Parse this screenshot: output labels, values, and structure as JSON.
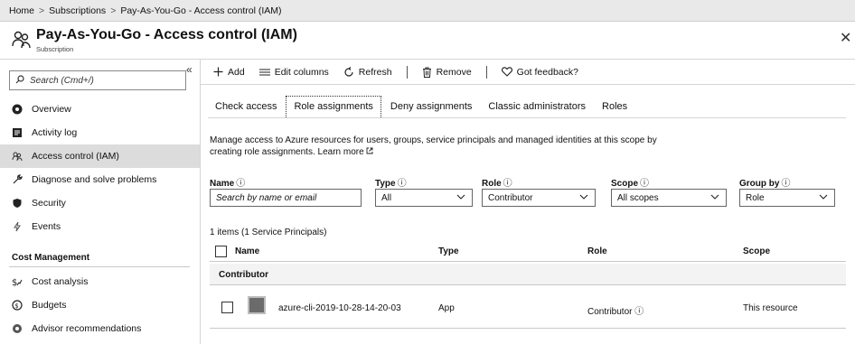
{
  "breadcrumb": {
    "items": [
      "Home",
      "Subscriptions",
      "Pay-As-You-Go - Access control (IAM)"
    ],
    "separator": ">"
  },
  "header": {
    "title": "Pay-As-You-Go - Access control (IAM)",
    "subtitle": "Subscription",
    "close_label": "✕",
    "icon": "people-icon"
  },
  "sidebar": {
    "search_placeholder": "Search (Cmd+/)",
    "collapse_label": "«",
    "items": [
      {
        "label": "Overview",
        "icon": "overview-icon"
      },
      {
        "label": "Activity log",
        "icon": "activity-log-icon"
      },
      {
        "label": "Access control (IAM)",
        "icon": "people-icon",
        "active": true
      },
      {
        "label": "Diagnose and solve problems",
        "icon": "wrench-icon"
      },
      {
        "label": "Security",
        "icon": "shield-icon"
      },
      {
        "label": "Events",
        "icon": "lightning-icon"
      }
    ],
    "section_heading": "Cost Management",
    "cost_items": [
      {
        "label": "Cost analysis",
        "icon": "cost-analysis-icon"
      },
      {
        "label": "Budgets",
        "icon": "budgets-icon"
      },
      {
        "label": "Advisor recommendations",
        "icon": "advisor-icon"
      }
    ]
  },
  "toolbar": {
    "add_label": "Add",
    "edit_columns_label": "Edit columns",
    "refresh_label": "Refresh",
    "remove_label": "Remove",
    "feedback_label": "Got feedback?"
  },
  "tabs": [
    {
      "label": "Check access"
    },
    {
      "label": "Role assignments",
      "active": true
    },
    {
      "label": "Deny assignments"
    },
    {
      "label": "Classic administrators"
    },
    {
      "label": "Roles"
    }
  ],
  "description": {
    "text": "Manage access to Azure resources for users, groups, service principals and managed identities at this scope by creating role assignments.",
    "learn_more": "Learn more"
  },
  "filters": {
    "name": {
      "label": "Name",
      "placeholder": "Search by name or email"
    },
    "type": {
      "label": "Type",
      "value": "All"
    },
    "role": {
      "label": "Role",
      "value": "Contributor"
    },
    "scope": {
      "label": "Scope",
      "value": "All scopes"
    },
    "group_by": {
      "label": "Group by",
      "value": "Role"
    }
  },
  "table": {
    "count_text": "1 items (1 Service Principals)",
    "columns": {
      "name": "Name",
      "type": "Type",
      "role": "Role",
      "scope": "Scope"
    },
    "group_label": "Contributor",
    "rows": [
      {
        "name": "azure-cli-2019-10-28-14-20-03",
        "type": "App",
        "role": "Contributor",
        "scope": "This resource"
      }
    ]
  },
  "colors": {
    "active_nav_bg": "#dcdcdc",
    "breadcrumb_bg": "#e9e9e9",
    "border": "#d5d5d5"
  }
}
